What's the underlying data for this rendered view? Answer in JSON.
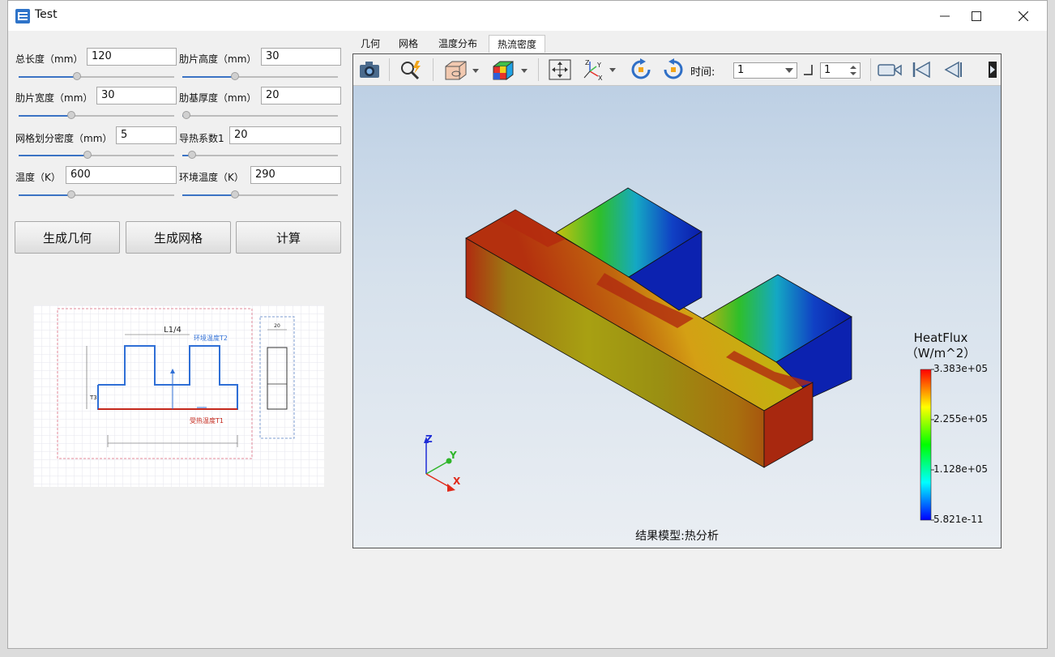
{
  "window": {
    "title": "Test"
  },
  "params": [
    {
      "label": "总长度（mm）",
      "value": "120",
      "level": 0.37
    },
    {
      "label": "肋片高度（mm）",
      "value": "30",
      "level": 0.33
    },
    {
      "label": "肋片宽度（mm）",
      "value": "30",
      "level": 0.33
    },
    {
      "label": "肋基厚度（mm）",
      "value": "20",
      "level": 0.0
    },
    {
      "label": "网格划分密度（mm）",
      "value": "5",
      "level": 0.44
    },
    {
      "label": "导热系数1",
      "value": "20",
      "level": 0.04
    },
    {
      "label": "温度（K）",
      "value": "600",
      "level": 0.33
    },
    {
      "label": "环境温度（K）",
      "value": "290",
      "level": 0.33
    }
  ],
  "buttons": {
    "generate_geometry": "生成几何",
    "generate_mesh": "生成网格",
    "compute": "计算"
  },
  "diagram": {
    "dim_top": "L1/4",
    "ambient_label": "环境温度T2",
    "heat_label": "受热温度T1",
    "side_dim": "20",
    "left_label": "T3"
  },
  "tabs": [
    {
      "label": "几何",
      "active": false
    },
    {
      "label": "网格",
      "active": false
    },
    {
      "label": "温度分布",
      "active": false
    },
    {
      "label": "热流密度",
      "active": true
    }
  ],
  "viewer": {
    "time_label": "时间:",
    "time_value": "1",
    "step_value": "1",
    "caption": "结果模型:热分析",
    "legend": {
      "title_line1": "HeatFlux",
      "title_line2": "（W/m^2）",
      "max": "3.383e+05",
      "mid_high": "2.255e+05",
      "mid_low": "1.128e+05",
      "min": "5.821e-11"
    },
    "axes": {
      "x": "X",
      "y": "Y",
      "z": "Z"
    }
  },
  "colors": {
    "accent": "#3b73c4",
    "heat_red": "#b22a10",
    "cold_blue": "#0a1ca8"
  }
}
